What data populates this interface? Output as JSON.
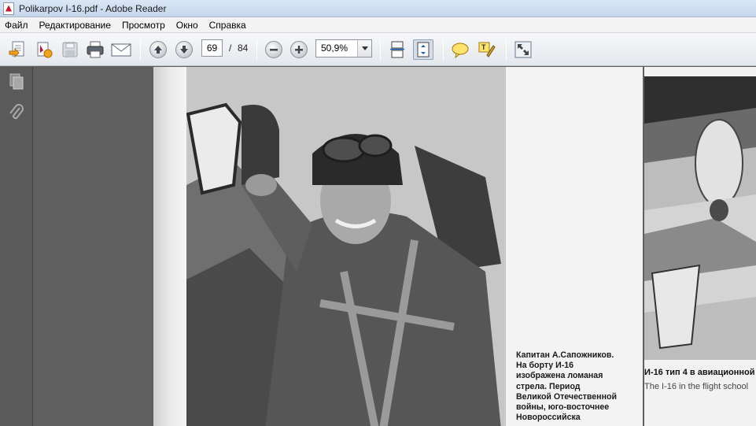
{
  "window": {
    "title": "Polikarpov I-16.pdf - Adobe Reader"
  },
  "menu": [
    "Файл",
    "Редактирование",
    "Просмотр",
    "Окно",
    "Справка"
  ],
  "toolbar": {
    "page_current": "69",
    "page_separator": "/",
    "page_total": "84",
    "zoom": "50,9%"
  },
  "icons": {
    "create": "create-pdf-icon",
    "save": "save-icon",
    "print": "print-icon",
    "email": "email-icon",
    "prev": "previous-page-icon",
    "next": "next-page-icon",
    "zoom_out": "zoom-out-icon",
    "zoom_in": "zoom-in-icon",
    "scroll": "scrolling-mode-icon",
    "fit": "fit-page-icon",
    "comment": "sticky-note-icon",
    "highlight": "highlight-icon",
    "fullscreen": "full-screen-icon"
  },
  "document": {
    "caption_lines": [
      "Капитан А.Сапожников.",
      "На борту И-16",
      "изображена ломаная",
      "стрела. Период",
      "Великой Отечественной",
      "войны, юго-восточнее",
      "Новороссийска"
    ],
    "page2_caption_ru": "И-16 тип 4 в авиационной",
    "page2_caption_en": "The I-16 in the flight school"
  }
}
